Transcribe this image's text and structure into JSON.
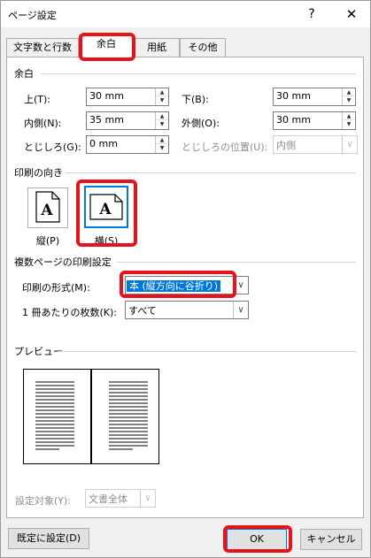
{
  "window": {
    "title": "ページ設定",
    "help": "?",
    "close": "✕"
  },
  "tabs": [
    {
      "label": "文字数と行数"
    },
    {
      "label": "余白"
    },
    {
      "label": "用紙"
    },
    {
      "label": "その他"
    }
  ],
  "margins": {
    "heading": "余白",
    "top_label": "上(T):",
    "top_value": "30 mm",
    "bottom_label": "下(B):",
    "bottom_value": "30 mm",
    "inner_label": "内側(N):",
    "inner_value": "35 mm",
    "outer_label": "外側(O):",
    "outer_value": "30 mm",
    "gutter_label": "とじしろ(G):",
    "gutter_value": "0 mm",
    "gutter_pos_label": "とじしろの位置(U):",
    "gutter_pos_value": "内側"
  },
  "orientation": {
    "heading": "印刷の向き",
    "portrait_label": "縦(P)",
    "landscape_label": "横(S)",
    "icon_letter": "A"
  },
  "multiple_pages": {
    "heading": "複数ページの印刷設定",
    "format_label": "印刷の形式(M):",
    "format_value": "本 (縦方向に谷折り)",
    "sheets_label": "1 冊あたりの枚数(K):",
    "sheets_value": "すべて"
  },
  "preview": {
    "heading": "プレビュー"
  },
  "apply": {
    "label": "設定対象(Y):",
    "value": "文書全体"
  },
  "buttons": {
    "default": "既定に設定(D)",
    "ok": "OK",
    "cancel": "キャンセル"
  },
  "colors": {
    "highlight": "#e8121a",
    "selection": "#0078d7"
  }
}
